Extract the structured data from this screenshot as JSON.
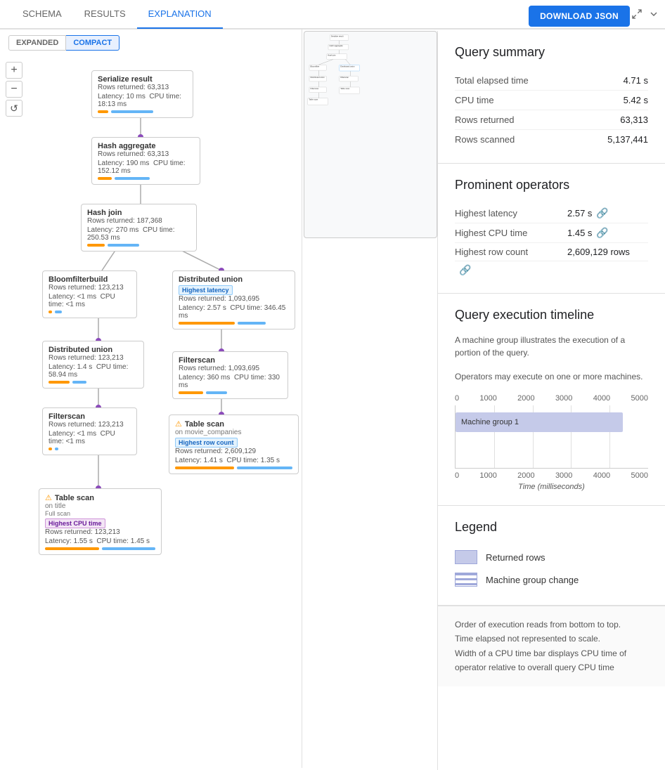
{
  "tabs": [
    {
      "label": "SCHEMA",
      "active": false
    },
    {
      "label": "RESULTS",
      "active": false
    },
    {
      "label": "EXPLANATION",
      "active": true
    }
  ],
  "download_btn": "DOWNLOAD JSON",
  "view_toggle": {
    "expanded": "EXPANDED",
    "compact": "COMPACT",
    "active": "COMPACT"
  },
  "query_summary": {
    "title": "Query summary",
    "rows": [
      {
        "label": "Total elapsed time",
        "value": "4.71 s"
      },
      {
        "label": "CPU time",
        "value": "5.42 s"
      },
      {
        "label": "Rows returned",
        "value": "63,313"
      },
      {
        "label": "Rows scanned",
        "value": "5,137,441"
      }
    ]
  },
  "prominent_operators": {
    "title": "Prominent operators",
    "rows": [
      {
        "label": "Highest latency",
        "value": "2.57 s"
      },
      {
        "label": "Highest CPU time",
        "value": "1.45 s"
      },
      {
        "label": "Highest row count",
        "value": "2,609,129 rows"
      }
    ]
  },
  "timeline": {
    "title": "Query execution timeline",
    "desc1": "A machine group illustrates the execution of a portion of the query.",
    "desc2": "Operators may execute on one or more machines.",
    "axis_top": [
      "0",
      "1000",
      "2000",
      "3000",
      "4000",
      "5000"
    ],
    "axis_bottom": [
      "0",
      "1000",
      "2000",
      "3000",
      "4000",
      "5000"
    ],
    "bar_label": "Machine group 1",
    "x_label": "Time (milliseconds)"
  },
  "legend": {
    "title": "Legend",
    "items": [
      {
        "label": "Returned rows",
        "type": "rows"
      },
      {
        "label": "Machine group change",
        "type": "group"
      }
    ]
  },
  "footer_notes": [
    "Order of execution reads from bottom to top.",
    "Time elapsed not represented to scale.",
    "Width of a CPU time bar displays CPU time of operator relative to overall query CPU time"
  ],
  "nodes": {
    "serialize": {
      "title": "Serialize result",
      "rows": "Rows returned: 63,313",
      "latency": "Latency: 10 ms",
      "cpu": "CPU time: 18:13 ms",
      "bar_orange_w": 15,
      "bar_blue_w": 60
    },
    "hash_agg": {
      "title": "Hash aggregate",
      "rows": "Rows returned: 63,313",
      "latency": "Latency: 190 ms",
      "cpu": "CPU time: 152.12 ms",
      "bar_orange_w": 20,
      "bar_blue_w": 50
    },
    "hash_join": {
      "title": "Hash join",
      "rows": "Rows returned: 187,368",
      "latency": "Latency: 270 ms",
      "cpu": "CPU time: 250.53 ms",
      "bar_orange_w": 25,
      "bar_blue_w": 45
    },
    "bloom_filter": {
      "title": "Bloomfilterbuild",
      "rows": "Rows returned: 123,213",
      "latency": "Latency: <1 ms",
      "cpu": "CPU time: <1 ms",
      "bar_orange_w": 5,
      "bar_blue_w": 10
    },
    "dist_union1": {
      "title": "Distributed union",
      "badge": "Highest latency",
      "badge_type": "blue",
      "rows": "Rows returned: 1,093,695",
      "latency": "Latency: 2.57 s",
      "cpu": "CPU time: 346.45 ms",
      "bar_orange_w": 80,
      "bar_blue_w": 40
    },
    "dist_union2": {
      "title": "Distributed union",
      "rows": "Rows returned: 123,213",
      "latency": "Latency: 1.4 s",
      "cpu": "CPU time: 58.94 ms",
      "bar_orange_w": 30,
      "bar_blue_w": 20
    },
    "filterscan1": {
      "title": "Filterscan",
      "rows": "Rows returned: 1,093,695",
      "latency": "Latency: 360 ms",
      "cpu": "CPU time: 330 ms",
      "bar_orange_w": 35,
      "bar_blue_w": 30
    },
    "filterscan2": {
      "title": "Filterscan",
      "rows": "Rows returned: 123,213",
      "latency": "Latency: <1 ms",
      "cpu": "CPU time: <1 ms",
      "bar_orange_w": 5,
      "bar_blue_w": 5
    },
    "table_scan_movie": {
      "title": "Table scan",
      "subtitle": "on movie_companies",
      "badge": "Highest row count",
      "badge_type": "blue",
      "rows": "Rows returned: 2,609,129",
      "latency": "Latency: 1.41 s",
      "cpu": "CPU time: 1.35 s",
      "bar_orange_w": 90,
      "bar_blue_w": 85,
      "warn": true
    },
    "table_scan_title": {
      "title": "Table scan",
      "subtitle": "on title",
      "scan_type": "Full scan",
      "badge": "Highest CPU time",
      "badge_type": "purple",
      "rows": "Rows returned: 123,213",
      "latency": "Latency: 1.55 s",
      "cpu": "CPU time: 1.45 s",
      "bar_orange_w": 90,
      "bar_blue_w": 88,
      "warn": true
    }
  }
}
